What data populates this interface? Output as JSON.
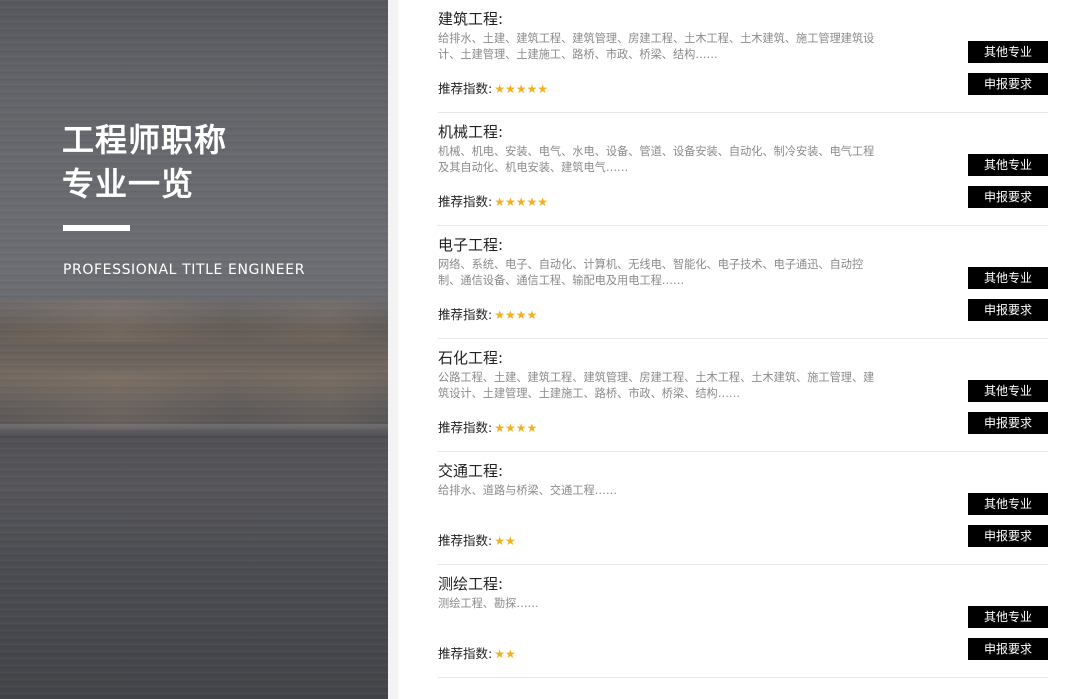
{
  "hero": {
    "title_line1": "工程师职称",
    "title_line2": "专业一览",
    "subtitle": "PROFESSIONAL TITLE ENGINEER"
  },
  "labels": {
    "rating_label": "推荐指数:",
    "other_button": "其他专业",
    "requirements_button": "申报要求"
  },
  "colors": {
    "star": "#f2b01e",
    "button_bg": "#000000",
    "button_text": "#ffffff"
  },
  "items": [
    {
      "title": "建筑工程:",
      "desc": "给排水、土建、建筑工程、建筑管理、房建工程、土木工程、土木建筑、施工管理建筑设计、土建管理、土建施工、路桥、市政、桥梁、结构……",
      "stars": 5
    },
    {
      "title": "机械工程:",
      "desc": "机械、机电、安装、电气、水电、设备、管道、设备安装、自动化、制冷安装、电气工程及其自动化、机电安装、建筑电气……",
      "stars": 5
    },
    {
      "title": "电子工程:",
      "desc": "网络、系统、电子、自动化、计算机、无线电、智能化、电子技术、电子通迅、自动控制、通信设备、通信工程、输配电及用电工程……",
      "stars": 4
    },
    {
      "title": "石化工程:",
      "desc": "公路工程、土建、建筑工程、建筑管理、房建工程、土木工程、土木建筑、施工管理、建筑设计、土建管理、土建施工、路桥、市政、桥梁、结构……",
      "stars": 4
    },
    {
      "title": "交通工程:",
      "desc": "给排水、道路与桥梁、交通工程……",
      "stars": 2
    },
    {
      "title": "测绘工程:",
      "desc": "测绘工程、勘探……",
      "stars": 2
    }
  ]
}
